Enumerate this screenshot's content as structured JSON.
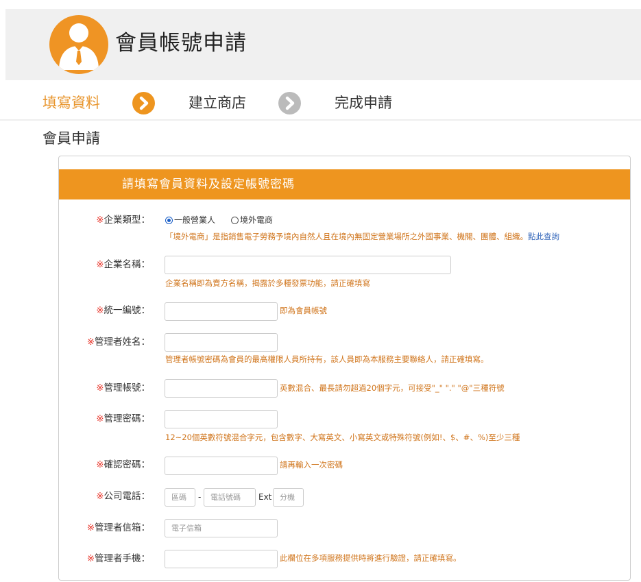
{
  "header": {
    "title": "會員帳號申請"
  },
  "steps": [
    {
      "label": "填寫資料",
      "active": true
    },
    {
      "label": "建立商店",
      "active": false
    },
    {
      "label": "完成申請",
      "active": false
    }
  ],
  "section_title": "會員申請",
  "form": {
    "heading": "請填寫會員資料及設定帳號密碼",
    "required_mark": "※",
    "business_type": {
      "label": "企業類型：",
      "options": [
        "一般營業人",
        "境外電商"
      ],
      "selected": "一般營業人",
      "hint": "「境外電商」是指銷售電子勞務予境內自然人且在境內無固定營業場所之外國事業、機關、團體、組織。",
      "hint_link": "點此查詢"
    },
    "company_name": {
      "label": "企業名稱：",
      "hint": "企業名稱即為賣方名稱，揭露於多種發票功能，請正確填寫"
    },
    "tax_id": {
      "label": "統一編號：",
      "hint": "即為會員帳號"
    },
    "admin_name": {
      "label": "管理者姓名：",
      "hint": "管理者帳號密碼為會員的最高權限人員所持有，該人員即為本服務主要聯絡人，請正確填寫。"
    },
    "admin_account": {
      "label": "管理帳號：",
      "hint": "英數混合、最長請勿超過20個字元，可接受\"_\" \".\" \"@\"三種符號"
    },
    "admin_password": {
      "label": "管理密碼：",
      "hint": "12~20個英數符號混合字元，包含數字、大寫英文、小寫英文或特殊符號(例如!、$、#、%)至少三種"
    },
    "confirm_password": {
      "label": "確認密碼：",
      "hint": "請再輸入一次密碼"
    },
    "company_phone": {
      "label": "公司電話：",
      "area_placeholder": "區碼",
      "dash": "-",
      "number_placeholder": "電話號碼",
      "ext_label": "Ext",
      "ext_placeholder": "分機"
    },
    "admin_email": {
      "label": "管理者信箱：",
      "placeholder": "電子信箱"
    },
    "admin_mobile": {
      "label": "管理者手機：",
      "hint": "此欄位在多項服務提供時將進行驗證，請正確填寫。"
    }
  },
  "colors": {
    "accent": "#ee951f",
    "required": "#e8352a",
    "hint": "#d0751c",
    "link": "#3d6dbd",
    "inactive_step": "#bbbbbb"
  },
  "icons": {
    "avatar": "user-avatar-icon",
    "step_next": "chevron-right-circle-icon"
  }
}
